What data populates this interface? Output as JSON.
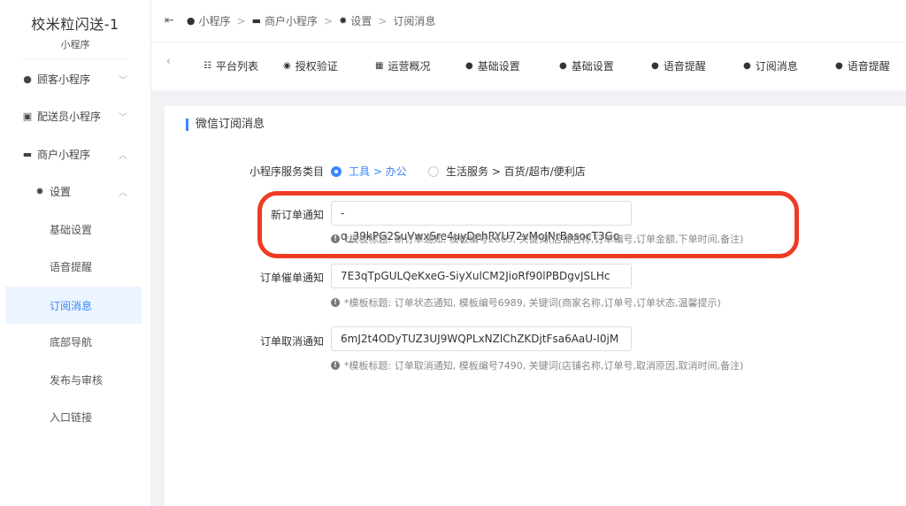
{
  "brand": {
    "title": "校米粒闪送-1",
    "subtitle": "小程序"
  },
  "sidebar": {
    "items": [
      {
        "label": "顾客小程序",
        "icon": "account-circle-icon",
        "chevron": "﹀"
      },
      {
        "label": "配送员小程序",
        "icon": "delivery-icon",
        "chevron": "﹀"
      },
      {
        "label": "商户小程序",
        "icon": "store-icon",
        "chevron": "︿"
      },
      {
        "label": "设置",
        "icon": "gear-icon",
        "chevron": "︿"
      }
    ],
    "subitems": [
      "基础设置",
      "语音提醒",
      "订阅消息",
      "底部导航",
      "发布与审核",
      "入口链接"
    ],
    "active_subitem": "订阅消息"
  },
  "breadcrumb": {
    "collapse_icon": "menu-fold-icon",
    "items": [
      "小程序",
      "商户小程序",
      "设置",
      "订阅消息"
    ],
    "separator": ">"
  },
  "tabs": [
    {
      "label": "平台列表",
      "icon": "list-icon"
    },
    {
      "label": "授权验证",
      "icon": "verify-icon"
    },
    {
      "label": "运营概况",
      "icon": "grid-icon"
    },
    {
      "label": "基础设置",
      "icon": "wechat-icon"
    },
    {
      "label": "基础设置",
      "icon": "wechat-icon"
    },
    {
      "label": "语音提醒",
      "icon": "wechat-icon"
    },
    {
      "label": "订阅消息",
      "icon": "wechat-icon"
    },
    {
      "label": "语音提醒",
      "icon": "wechat-icon"
    }
  ],
  "section": {
    "title": "微信订阅消息"
  },
  "form": {
    "category_label": "小程序服务类目",
    "category_options": [
      {
        "label": "工具 > 办公",
        "checked": true
      },
      {
        "label": "生活服务 > 百货/超市/便利店",
        "checked": false
      }
    ],
    "fields": [
      {
        "label": "新订单通知",
        "value": "-q_39kPG2SuVwxSre4uyDehRYU72vMoJNrBasocT3Go",
        "hint": "*模板标题: 新订单通知, 模板编号2665, 关键词(店铺名称,订单编号,订单金额,下单时间,备注)"
      },
      {
        "label": "订单催单通知",
        "value": "7E3qTpGULQeKxeG-SiyXulCM2JioRf90lPBDgvJSLHc",
        "hint": "*模板标题: 订单状态通知, 模板编号6989, 关键词(商家名称,订单号,订单状态,温馨提示)"
      },
      {
        "label": "订单取消通知",
        "value": "6mJ2t4ODyTUZ3UJ9WQPLxNZlChZKDjtFsa6AaU-I0jM",
        "hint": "*模板标题: 订单取消通知, 模板编号7490, 关键词(店铺名称,订单号,取消原因,取消时间,备注)"
      }
    ]
  },
  "colors": {
    "accent": "#3a86ff",
    "highlight": "#ef3b24",
    "content_bg": "#f1f2f5"
  }
}
